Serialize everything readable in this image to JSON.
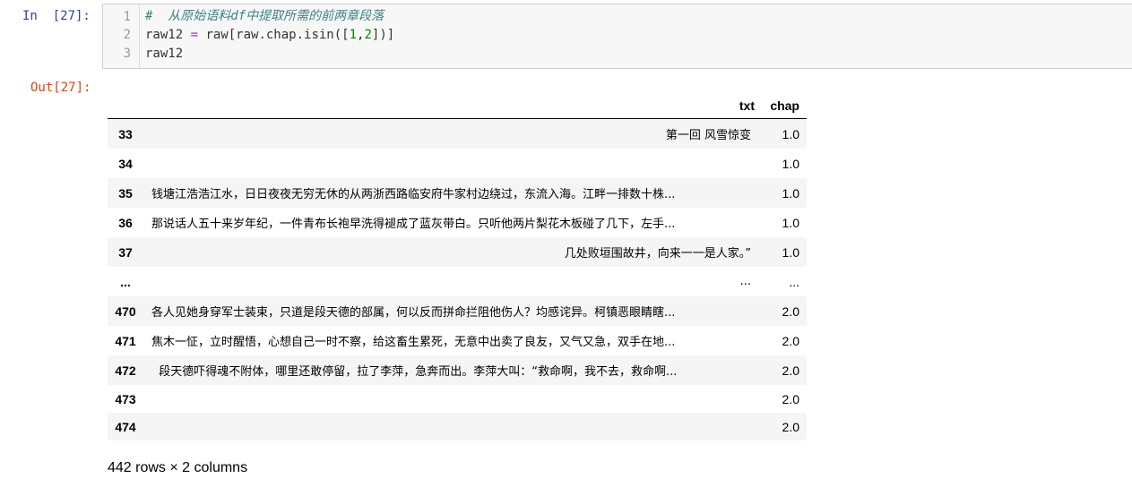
{
  "input_cell": {
    "prompt": "In  [27]:",
    "line_numbers": [
      "1",
      "2",
      "3"
    ],
    "line1": "#  从原始语料df中提取所需的前两章段落",
    "line2": {
      "a": "raw12 ",
      "op1": "=",
      "b": " raw[raw.chap.isin([",
      "n1": "1",
      "comma": ",",
      "n2": "2",
      "c": "])]"
    },
    "line3": "raw12"
  },
  "output_cell": {
    "prompt": "Out[27]:",
    "columns": [
      "",
      "txt",
      "chap"
    ],
    "rows": [
      {
        "index": "33",
        "txt": "第一回 风雪惊变",
        "chap": "1.0"
      },
      {
        "index": "34",
        "txt": "",
        "chap": "1.0"
      },
      {
        "index": "35",
        "txt": "钱塘江浩浩江水，日日夜夜无穷无休的从两浙西路临安府牛家村边绕过，东流入海。江畔一排数十株...",
        "chap": "1.0"
      },
      {
        "index": "36",
        "txt": "那说话人五十来岁年纪，一件青布长袍早洗得褪成了蓝灰带白。只听他两片梨花木板碰了几下，左手...",
        "chap": "1.0"
      },
      {
        "index": "37",
        "txt": "几处败垣围故井，向来一一是人家。”",
        "chap": "1.0"
      },
      {
        "index": "...",
        "txt": "...",
        "chap": "..."
      },
      {
        "index": "470",
        "txt": "各人见她身穿军士装束，只道是段天德的部属，何以反而拼命拦阻他伤人？均感诧异。柯镇恶眼睛瞎...",
        "chap": "2.0"
      },
      {
        "index": "471",
        "txt": "焦木一怔，立时醒悟，心想自己一时不察，给这畜生累死，无意中出卖了良友，又气又急，双手在地...",
        "chap": "2.0"
      },
      {
        "index": "472",
        "txt": "  段天德吓得魂不附体，哪里还敢停留，拉了李萍，急奔而出。李萍大叫：“救命啊，我不去，救命啊...",
        "chap": "2.0"
      },
      {
        "index": "473",
        "txt": "",
        "chap": "2.0"
      },
      {
        "index": "474",
        "txt": "",
        "chap": "2.0"
      }
    ],
    "shape": "442 rows × 2 columns"
  }
}
